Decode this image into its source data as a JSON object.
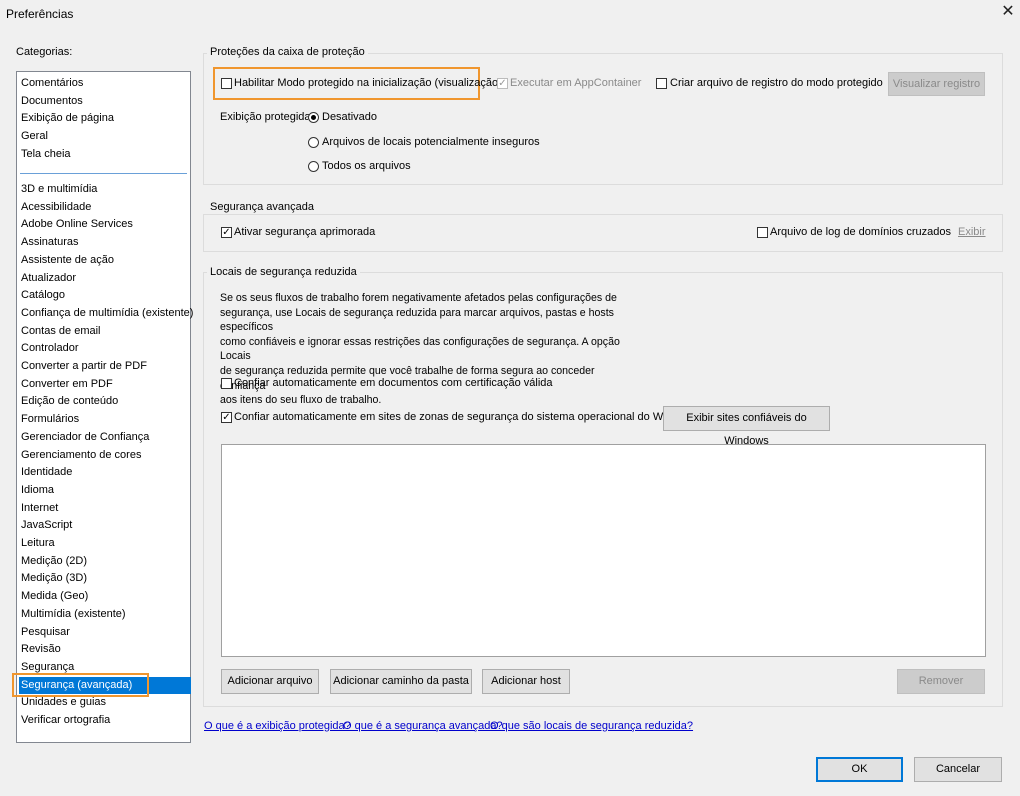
{
  "window": {
    "title": "Preferências"
  },
  "categories": {
    "label": "Categorias:",
    "top_items": [
      "Comentários",
      "Documentos",
      "Exibição de página",
      "Geral",
      "Tela cheia"
    ],
    "items": [
      "3D e multimídia",
      "Acessibilidade",
      "Adobe Online Services",
      "Assinaturas",
      "Assistente de ação",
      "Atualizador",
      "Catálogo",
      "Confiança de multimídia (existente)",
      "Contas de email",
      "Controlador",
      "Converter a partir de PDF",
      "Converter em PDF",
      "Edição de conteúdo",
      "Formulários",
      "Gerenciador de Confiança",
      "Gerenciamento de cores",
      "Identidade",
      "Idioma",
      "Internet",
      "JavaScript",
      "Leitura",
      "Medição (2D)",
      "Medição (3D)",
      "Medida (Geo)",
      "Multimídia (existente)",
      "Pesquisar",
      "Revisão",
      "Segurança",
      "Segurança (avançada)",
      "Unidades e guias",
      "Verificar ortografia"
    ],
    "selected": "Segurança (avançada)"
  },
  "sandbox": {
    "title": "Proteções da caixa de proteção",
    "protected_mode_label": "Habilitar Modo protegido na inicialização (visualização)",
    "appcontainer_label": "Executar em AppContainer",
    "log_label": "Criar arquivo de registro do modo protegido",
    "view_log_button": "Visualizar registro",
    "protected_view_label": "Exibição protegida",
    "radio_options": [
      "Desativado",
      "Arquivos de locais potencialmente inseguros",
      "Todos os arquivos"
    ]
  },
  "enhanced": {
    "title": "Segurança avançada",
    "enable_label": "Ativar segurança aprimorada",
    "cross_domain_label": "Arquivo de log de domínios cruzados",
    "view_link": "Exibir"
  },
  "privileged": {
    "title": "Locais de segurança reduzida",
    "description_lines": [
      "Se os seus fluxos de trabalho forem negativamente afetados pelas configurações de",
      "segurança, use Locais de segurança reduzida para marcar arquivos, pastas e hosts específicos",
      "como confiáveis e ignorar essas restrições das configurações de segurança. A opção Locais",
      "de segurança reduzida permite que você trabalhe de forma segura ao conceder confiança",
      "aos itens do seu fluxo de trabalho."
    ],
    "trust_certified_label": "Confiar automaticamente em documentos com certificação válida",
    "trust_os_zones_label": "Confiar automaticamente em sites de zonas de segurança do sistema operacional do Windows",
    "show_windows_sites_button": "Exibir sites confiáveis do Windows",
    "add_file_button": "Adicionar arquivo",
    "add_folder_button": "Adicionar caminho da pasta",
    "add_host_button": "Adicionar host",
    "remove_button": "Remover"
  },
  "links": {
    "protected_view_help": "O que é a exibição protegida?",
    "enhanced_help": "O que é a segurança avançada?",
    "privileged_help": "O que são locais de segurança reduzida?"
  },
  "footer": {
    "ok": "OK",
    "cancel": "Cancelar"
  },
  "colors": {
    "selection": "#0078d7",
    "highlight_outline": "#f0962e",
    "link": "#0000cc"
  }
}
